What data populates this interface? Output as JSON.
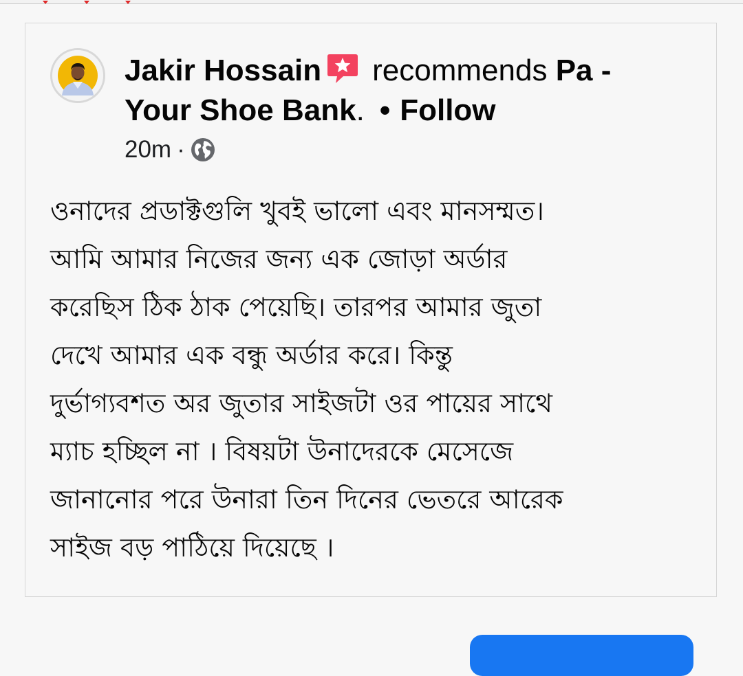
{
  "post": {
    "author_name": "Jakir Hossain",
    "recommends_text": "recommends",
    "page_name_part1": "Pa -",
    "page_name_part2": "Your Shoe Bank",
    "page_suffix": ".",
    "dot": "•",
    "follow_label": "Follow",
    "timestamp": "20m",
    "meta_sep": "·",
    "body_lines": [
      "ওনাদের প্রডাক্টগুলি খুবই ভালো এবং মানসম্মত।",
      "আমি আমার নিজের জন্য এক জোড়া অর্ডার",
      "করেছিস ঠিক ঠাক পেয়েছি। তারপর আমার জুতা",
      "দেখে আমার এক বন্ধু অর্ডার করে। কিন্তু",
      "দুর্ভাগ্যবশত অর জুতার সাইজটা ওর পায়ের সাথে",
      "ম্যাচ হচ্ছিল না । বিষয়টা উনাদেরকে মেসেজে",
      "জানানোর পরে উনারা তিন দিনের ভেতরে আরেক",
      "সাইজ বড় পাঠিয়ে দিয়েছে ।"
    ]
  },
  "icons": {
    "recommend_badge": "star-speech-bubble-icon",
    "privacy": "globe-icon"
  },
  "colors": {
    "badge_red": "#f3425f",
    "link_blue": "#1877f2",
    "text": "#050505",
    "background": "#f7f7f7"
  }
}
